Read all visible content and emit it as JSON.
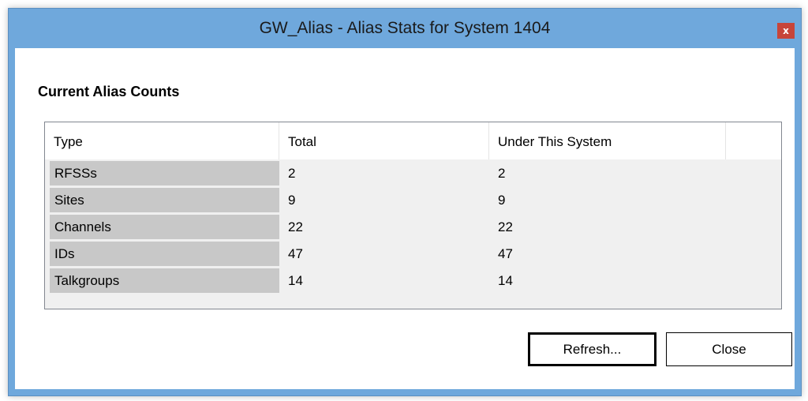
{
  "window": {
    "title": "GW_Alias - Alias Stats for System 1404",
    "close_glyph": "x"
  },
  "group": {
    "title": "Current Alias Counts"
  },
  "table": {
    "columns": [
      "Type",
      "Total",
      "Under This System"
    ],
    "rows": [
      {
        "type": "RFSSs",
        "total": "2",
        "under": "2"
      },
      {
        "type": "Sites",
        "total": "9",
        "under": "9"
      },
      {
        "type": "Channels",
        "total": "22",
        "under": "22"
      },
      {
        "type": "IDs",
        "total": "47",
        "under": "47"
      },
      {
        "type": "Talkgroups",
        "total": "14",
        "under": "14"
      }
    ]
  },
  "buttons": {
    "refresh_label": "Refresh...",
    "close_label": "Close"
  },
  "colors": {
    "titlebar": "#6fa8dc",
    "close_button": "#c7453a",
    "first_column_bg": "#c8c8c8",
    "list_bg": "#f0f0f0"
  }
}
